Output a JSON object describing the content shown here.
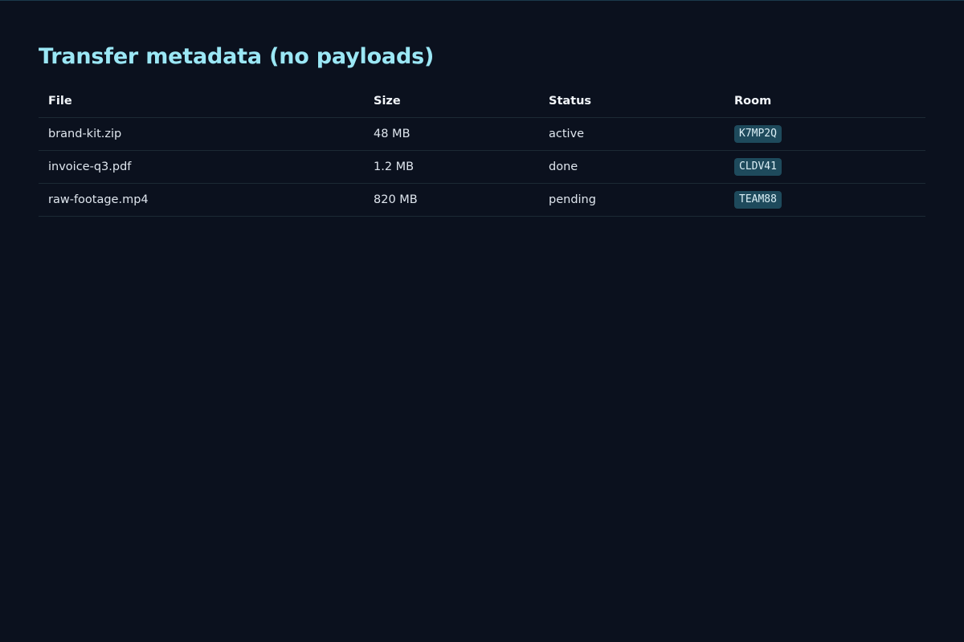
{
  "page": {
    "title": "Transfer metadata (no payloads)"
  },
  "table": {
    "columns": [
      "File",
      "Size",
      "Status",
      "Room"
    ],
    "rows": [
      {
        "file": "brand-kit.zip",
        "size": "48 MB",
        "status": "active",
        "room": "K7MP2Q"
      },
      {
        "file": "invoice-q3.pdf",
        "size": "1.2 MB",
        "status": "done",
        "room": "CLDV41"
      },
      {
        "file": "raw-footage.mp4",
        "size": "820 MB",
        "status": "pending",
        "room": "TEAM88"
      }
    ]
  },
  "colors": {
    "background": "#0b111e",
    "title": "#9be7f5",
    "room_badge": "#1e4a5c",
    "divider": "#1c2a34"
  }
}
